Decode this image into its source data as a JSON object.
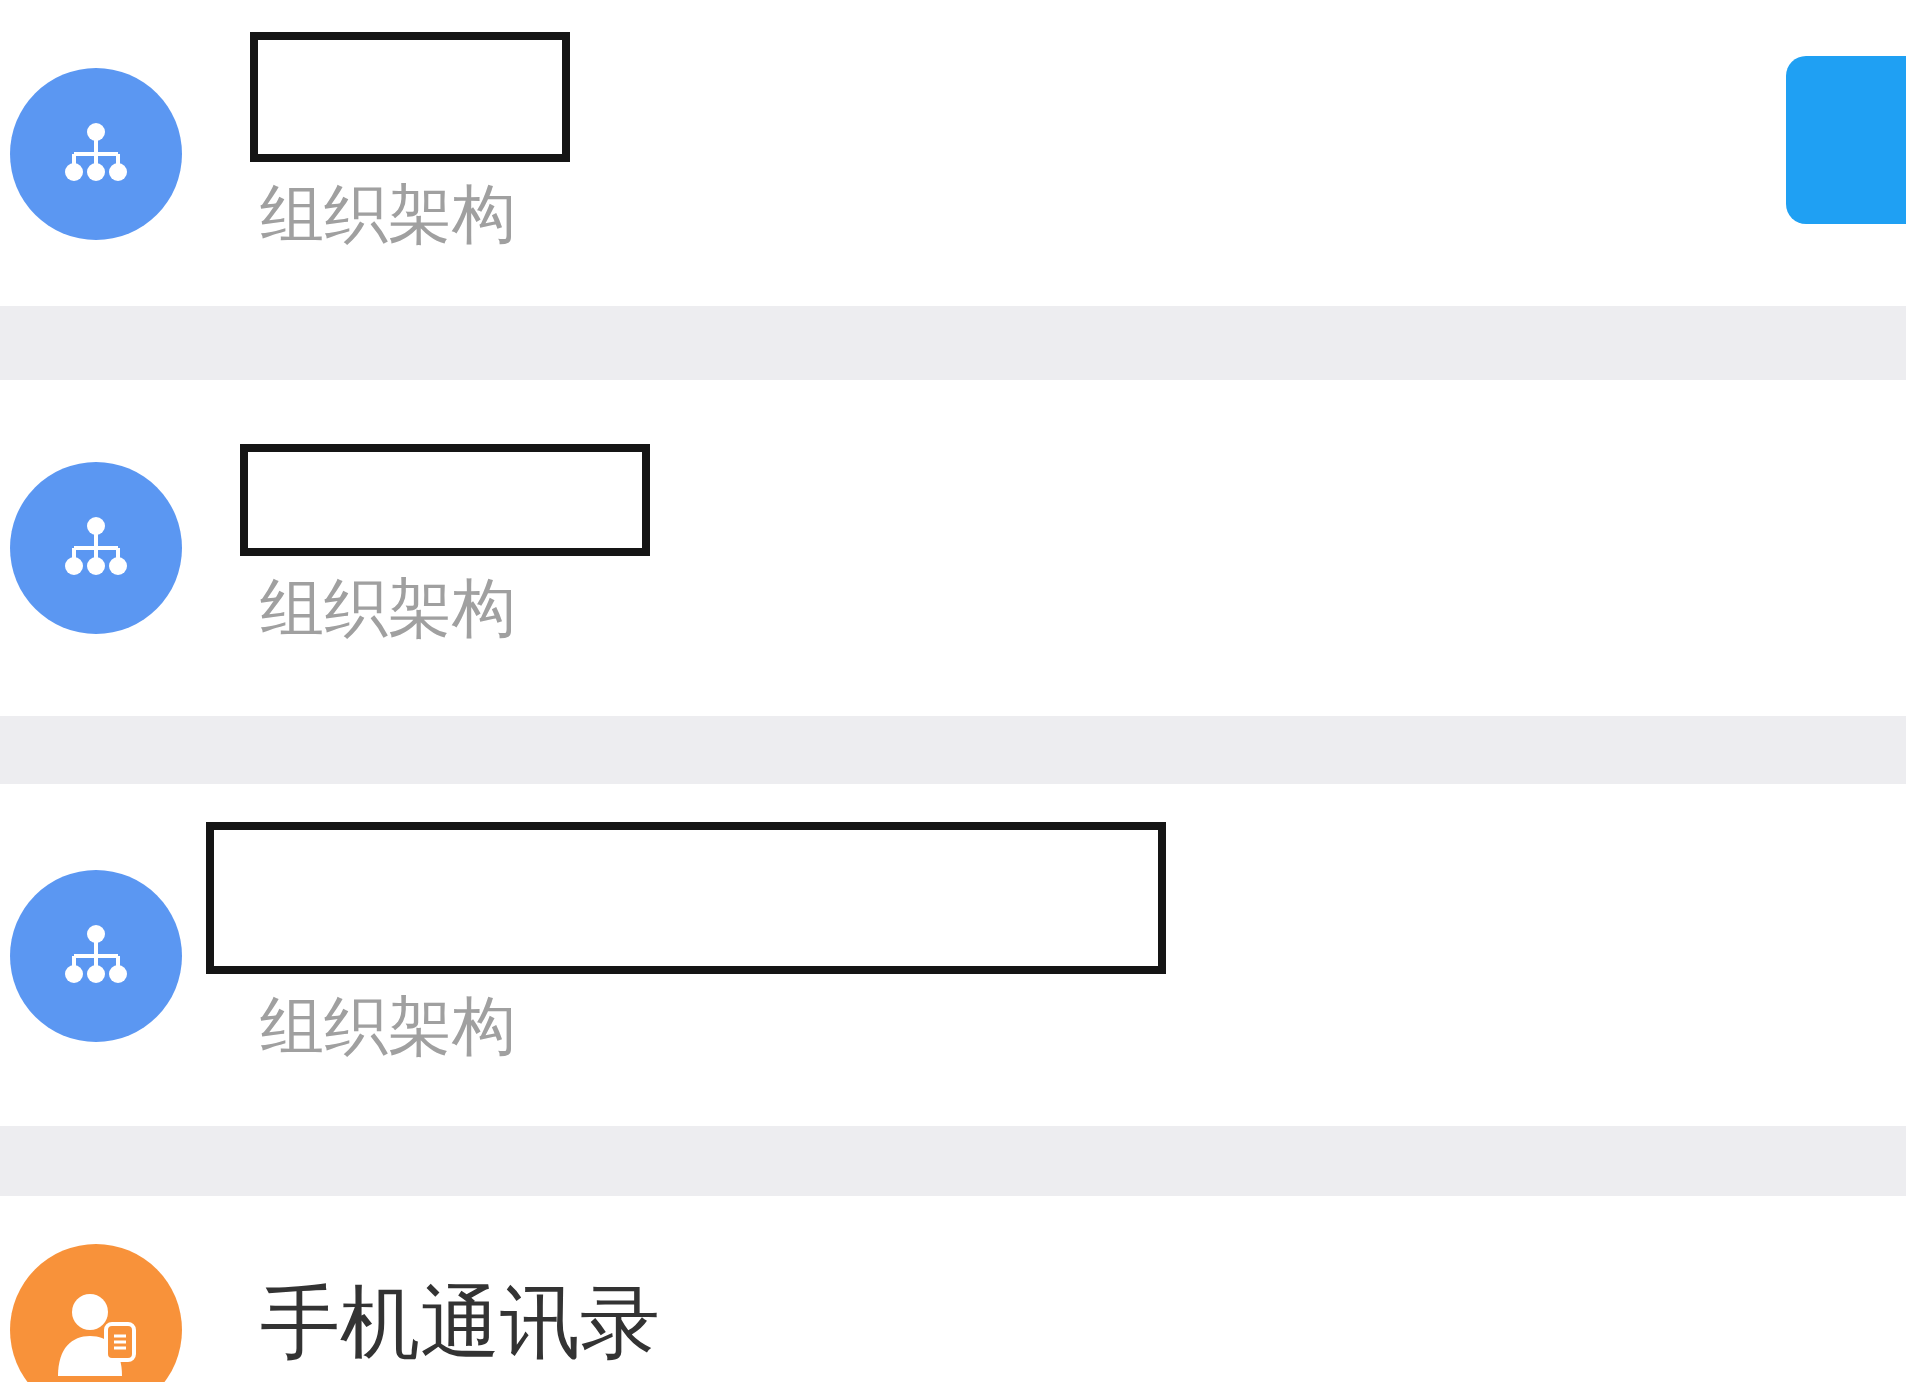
{
  "list": [
    {
      "kind": "org",
      "redacted": true,
      "subtitle": "组织架构",
      "has_button": true
    },
    {
      "kind": "org",
      "redacted": true,
      "subtitle": "组织架构",
      "has_button": false
    },
    {
      "kind": "org",
      "redacted": true,
      "subtitle": "组织架构",
      "has_button": false
    },
    {
      "kind": "contacts",
      "title": "手机通讯录"
    }
  ]
}
